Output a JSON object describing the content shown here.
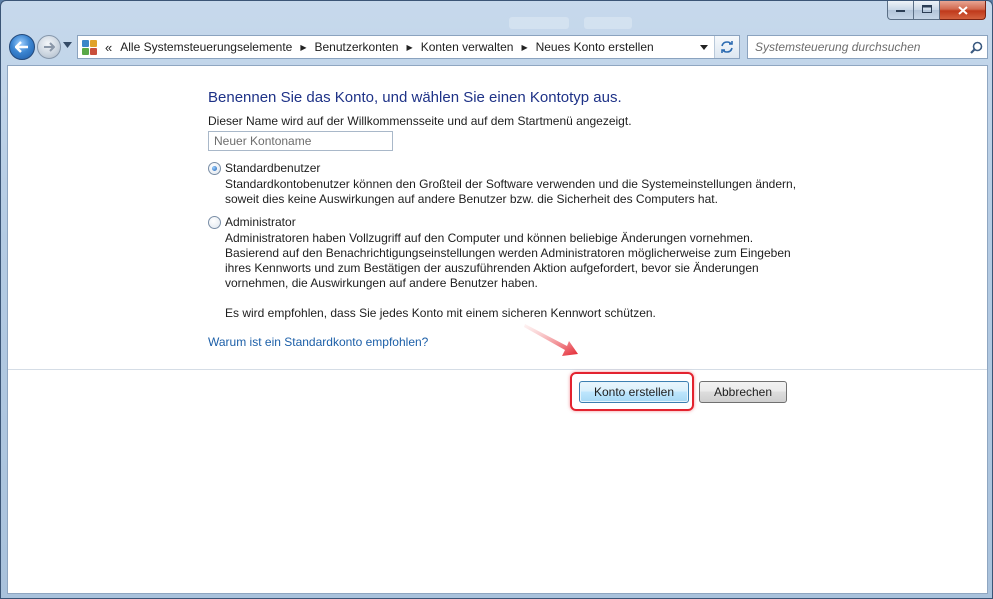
{
  "window": {
    "caption_buttons": {
      "minimize_icon": "minimize-icon",
      "maximize_icon": "maximize-icon",
      "close_icon": "close-icon"
    }
  },
  "navigation": {
    "back_icon": "arrow-left-icon",
    "forward_icon": "arrow-right-icon",
    "address": {
      "icon": "control-panel-icon",
      "overflow": "«",
      "breadcrumbs": [
        "Alle Systemsteuerungselemente",
        "Benutzerkonten",
        "Konten verwalten",
        "Neues Konto erstellen"
      ]
    },
    "search_placeholder": "Systemsteuerung durchsuchen"
  },
  "form": {
    "heading": "Benennen Sie das Konto, und wählen Sie einen Kontotyp aus.",
    "hint": "Dieser Name wird auf der Willkommensseite und auf dem Startmenü angezeigt.",
    "name_placeholder": "Neuer Kontoname",
    "options": [
      {
        "label": "Standardbenutzer",
        "selected": true,
        "description": [
          "Standardkontobenutzer können den Großteil der Software verwenden und die Systemeinstellungen ändern,",
          "soweit dies keine Auswirkungen auf andere Benutzer bzw. die Sicherheit des Computers hat."
        ]
      },
      {
        "label": "Administrator",
        "selected": false,
        "description": [
          "Administratoren haben Vollzugriff auf den Computer und können beliebige Änderungen vornehmen.",
          "Basierend auf den Benachrichtigungseinstellungen werden Administratoren möglicherweise zum Eingeben",
          "ihres Kennworts und zum Bestätigen der auszuführenden Aktion aufgefordert, bevor sie Änderungen",
          "vornehmen, die Auswirkungen auf andere Benutzer haben."
        ]
      }
    ],
    "recommendation": "Es wird empfohlen, dass Sie jedes Konto mit einem sicheren Kennwort schützen.",
    "info_link": "Warum ist ein Standardkonto empfohlen?",
    "create_button": "Konto erstellen",
    "cancel_button": "Abbrechen"
  },
  "colors": {
    "heading": "#1e3287",
    "link": "#1c5fa8",
    "highlight": "#e3232f"
  }
}
